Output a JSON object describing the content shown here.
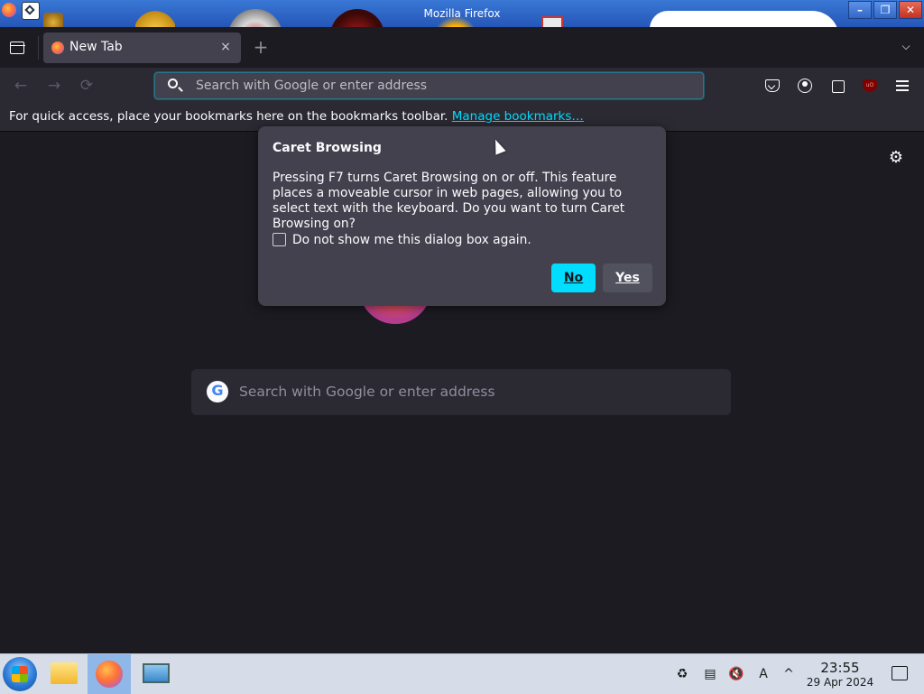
{
  "window": {
    "title": "Mozilla Firefox"
  },
  "tab": {
    "label": "New Tab",
    "close": "×"
  },
  "tabstrip": {
    "new_tab": "+",
    "overflow": "⌵"
  },
  "nav": {
    "back": "←",
    "forward": "→",
    "reload": "⟳"
  },
  "urlbar": {
    "placeholder": "Search with Google or enter address"
  },
  "bookmarks": {
    "message": "For quick access, place your bookmarks here on the bookmarks toolbar.",
    "link": "Manage bookmarks…"
  },
  "content": {
    "settings": "⚙",
    "search_placeholder": "Search with Google or enter address"
  },
  "dialog": {
    "title": "Caret Browsing",
    "body": "Pressing F7 turns Caret Browsing on or off. This feature places a moveable cursor in web pages, allowing you to select text with the keyboard. Do you want to turn Caret Browsing on?",
    "checkbox_label": "Do not show me this dialog box again.",
    "checkbox_checked": false,
    "no_label": "No",
    "yes_label": "Yes",
    "accent": "#00ddff"
  },
  "taskbar": {
    "time": "23:55",
    "date": "29 Apr 2024",
    "tray": {
      "chevron": "^",
      "volume": "🔇",
      "notes": "▤",
      "keyboard": "A"
    }
  },
  "colors": {
    "background": "#1c1b22",
    "toolbar": "#2b2a33",
    "dialog": "#42414d",
    "accent": "#00ddff"
  }
}
